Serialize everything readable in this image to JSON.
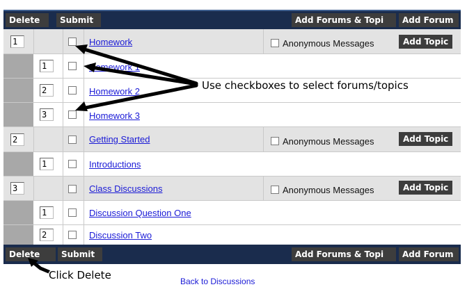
{
  "toolbar_top": {
    "delete_label": "Delete",
    "submit_label": "Submit",
    "add_forums_topics_label": "Add Forums & Topi",
    "add_forum_label": "Add Forum"
  },
  "toolbar_bottom": {
    "delete_label": "Delete",
    "submit_label": "Submit",
    "add_forums_topics_label": "Add Forums & Topi",
    "add_forum_label": "Add Forum"
  },
  "rows": [
    {
      "kind": "forum",
      "order": "1",
      "title": "Homework",
      "anon_label": "Anonymous Messages",
      "add_topic_label": "Add Topic"
    },
    {
      "kind": "topic",
      "order": "1",
      "title": "Homework 1"
    },
    {
      "kind": "topic",
      "order": "2",
      "title": "Homework 2"
    },
    {
      "kind": "topic",
      "order": "3",
      "title": "Homework 3"
    },
    {
      "kind": "forum",
      "order": "2",
      "title": "Getting Started",
      "anon_label": "Anonymous Messages",
      "add_topic_label": "Add Topic"
    },
    {
      "kind": "topic",
      "order": "1",
      "title": "Introductions"
    },
    {
      "kind": "forum",
      "order": "3",
      "title": "Class Discussions",
      "anon_label": "Anonymous Messages",
      "add_topic_label": "Add Topic"
    },
    {
      "kind": "topic",
      "order": "1",
      "title": "Discussion Question One"
    },
    {
      "kind": "topic",
      "order": "2",
      "title": "Discussion Two"
    }
  ],
  "annotations": {
    "checkbox_callout": "Use checkboxes to select forums/topics",
    "delete_callout": "Click Delete"
  },
  "footer": {
    "back_link": "Back to Discussions"
  },
  "colors": {
    "toolbar_bg": "#1a2c4d",
    "button_bg": "#3d3d3d",
    "forum_row_bg": "#e3e3e3",
    "gutter_bg": "#a8a8a8",
    "link": "#1a1ad6"
  }
}
